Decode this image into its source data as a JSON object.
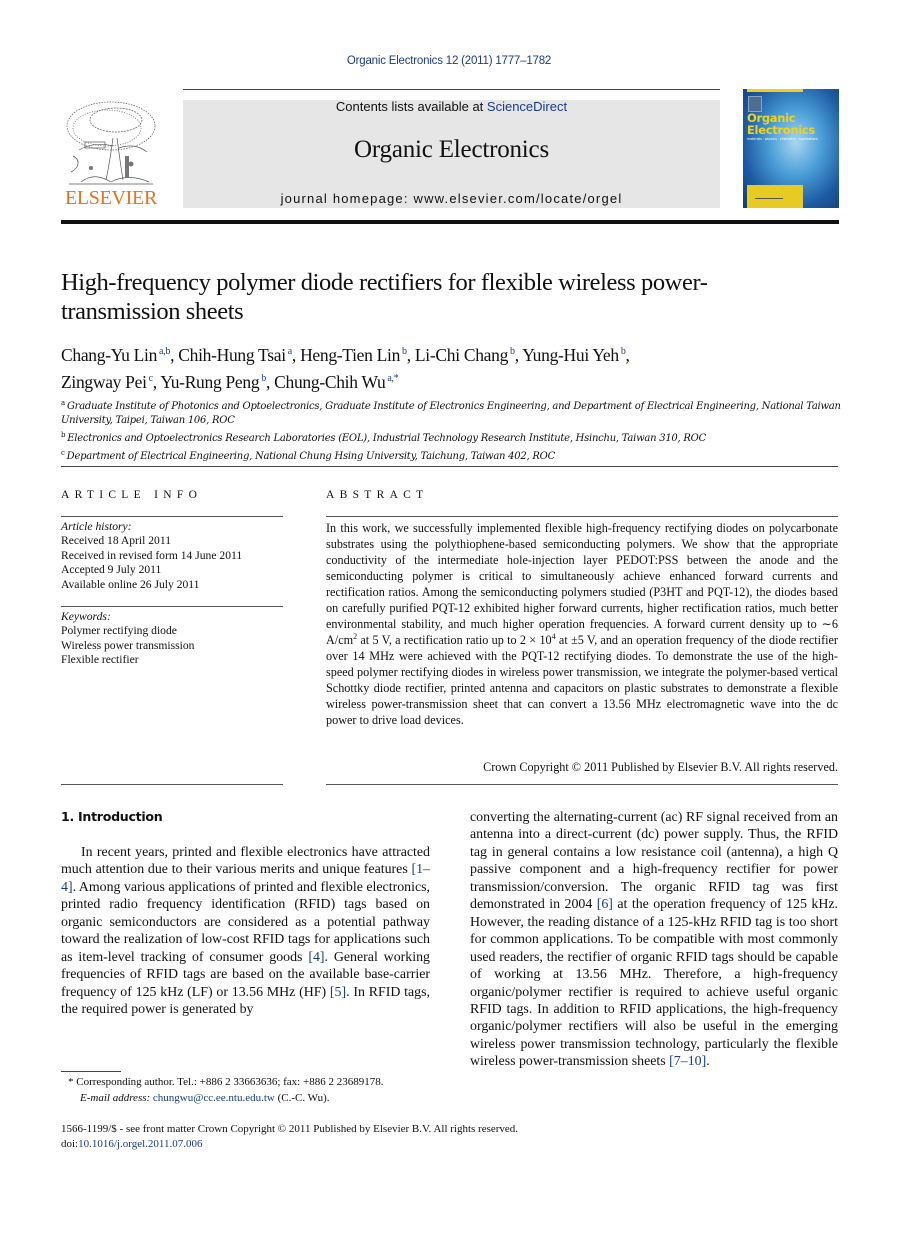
{
  "header": {
    "citation": "Organic Electronics 12 (2011) 1777–1782",
    "contents_prefix": "Contents lists available at ",
    "contents_link": "ScienceDirect",
    "journal_name": "Organic Electronics",
    "homepage": "journal homepage: www.elsevier.com/locate/orgel",
    "publisher_logo_text": "ELSEVIER",
    "cover": {
      "title_line1": "Organic",
      "title_line2": "Electronics",
      "subtitle": "materials · physics · chemistry · applications"
    },
    "colors": {
      "link": "#1a3a8a",
      "elsevier_orange": "#e9711c",
      "banner_gray": "#e6e6e6",
      "cover_yellow": "#f3d21a"
    }
  },
  "article": {
    "title": "High-frequency polymer diode rectifiers for flexible wireless power-transmission sheets",
    "authors": [
      {
        "name": "Chang-Yu Lin",
        "affil": "a,b"
      },
      {
        "name": "Chih-Hung Tsai",
        "affil": "a"
      },
      {
        "name": "Heng-Tien Lin",
        "affil": "b"
      },
      {
        "name": "Li-Chi Chang",
        "affil": "b"
      },
      {
        "name": "Yung-Hui Yeh",
        "affil": "b"
      },
      {
        "name": "Zingway Pei",
        "affil": "c"
      },
      {
        "name": "Yu-Rung Peng",
        "affil": "b"
      },
      {
        "name": "Chung-Chih Wu",
        "affil": "a,*"
      }
    ],
    "affiliations": [
      {
        "key": "a",
        "text": "Graduate Institute of Photonics and Optoelectronics, Graduate Institute of Electronics Engineering, and Department of Electrical Engineering, National Taiwan University, Taipei, Taiwan 106, ROC"
      },
      {
        "key": "b",
        "text": "Electronics and Optoelectronics Research Laboratories (EOL), Industrial Technology Research Institute, Hsinchu, Taiwan 310, ROC"
      },
      {
        "key": "c",
        "text": "Department of Electrical Engineering, National Chung Hsing University, Taichung, Taiwan 402, ROC"
      }
    ]
  },
  "article_info": {
    "heading": "ARTICLE INFO",
    "history_label": "Article history:",
    "history": [
      "Received 18 April 2011",
      "Received in revised form 14 June 2011",
      "Accepted 9 July 2011",
      "Available online 26 July 2011"
    ],
    "keywords_label": "Keywords:",
    "keywords": [
      "Polymer rectifying diode",
      "Wireless power transmission",
      "Flexible rectifier"
    ]
  },
  "abstract": {
    "heading": "ABSTRACT",
    "part1": "In this work, we successfully implemented flexible high-frequency rectifying diodes on polycarbonate substrates using the polythiophene-based semiconducting polymers. We show that the appropriate conductivity of the intermediate hole-injection layer PED­OT:PSS between the anode and the semiconducting polymer is critical to simultaneously achieve enhanced forward currents and rectification ratios. Among the semiconducting polymers studied (P3HT and PQT-12), the diodes based on carefully purified PQT-12 exhibited higher forward currents, higher rectification ratios, much better environmen­tal stability, and much higher operation frequencies. A forward current density up to ∼6 A/cm",
    "sup1": "2",
    "part2": " at 5 V, a rectification ratio up to 2 × 10",
    "sup2": "4",
    "part3": " at ±5 V, and an operation frequency of the diode rectifier over 14 MHz were achieved with the PQT-12 rectifying diodes. To demonstrate the use of the high-speed polymer rectifying diodes in wireless power transmission, we integrate the polymer-based vertical Schottky diode rectifier, printed antenna and capacitors on plastic substrates to demonstrate a flexible wireless power-transmission sheet that can convert a 13.56 MHz electromagnetic wave into the dc power to drive load devices.",
    "copyright": "Crown Copyright © 2011 Published by Elsevier B.V. All rights reserved."
  },
  "body": {
    "section_heading": "1. Introduction",
    "left": {
      "t1": "In recent years, printed and flexible electronics have attracted much attention due to their various merits and unique features ",
      "ref1": "[1–4]",
      "t2": ". Among various applications of printed and flexible electronics, printed radio frequency identification (RFID) tags based on organic semiconductors are considered as a potential pathway toward the realiza­tion of low-cost RFID tags for applications such as item-le­vel tracking of consumer goods ",
      "ref2": "[4]",
      "t3": ". General working frequencies of RFID tags are based on the available base-carrier frequency of 125 kHz (LF) or 13.56 MHz (HF) ",
      "ref3": "[5]",
      "t4": ". In RFID tags, the required power is generated by"
    },
    "right": {
      "t1": "converting the alternating-current (ac) RF signal received from an antenna into a direct-current (dc) power supply. Thus, the RFID tag in general contains a low resistance coil (antenna), a high Q passive component and a high-fre­quency rectifier for power transmission/conversion. The organic RFID tag was first demonstrated in 2004 ",
      "ref1": "[6]",
      "t2": " at the operation frequency of 125 kHz. However, the reading distance of a 125-kHz RFID tag is too short for common applications. To be compatible with most commonly used readers, the rectifier of organic RFID tags should be capable of working at 13.56 MHz. Therefore, a high-frequency organic/polymer rectifier is required to achieve useful organic RFID tags. In addition to RFID applications, the high-frequency organic/polymer rectifiers will also be useful in the emerging wireless power transmission technology, particularly the flexible wireless power-trans­mission sheets ",
      "ref2": "[7–10]",
      "t3": "."
    }
  },
  "footnote": {
    "marker": "*",
    "corresponding": " Corresponding author. Tel.: +886 2 33663636; fax: +886 2 23689178.",
    "email_label": "E-mail address:",
    "email": "chungwu@cc.ee.ntu.edu.tw",
    "email_suffix": " (C.-C. Wu)."
  },
  "front_matter": {
    "issn_line": "1566-1199/$ - see front matter Crown Copyright © 2011 Published by Elsevier B.V. All rights reserved.",
    "doi_prefix": "doi:",
    "doi": "10.1016/j.orgel.2011.07.006"
  }
}
